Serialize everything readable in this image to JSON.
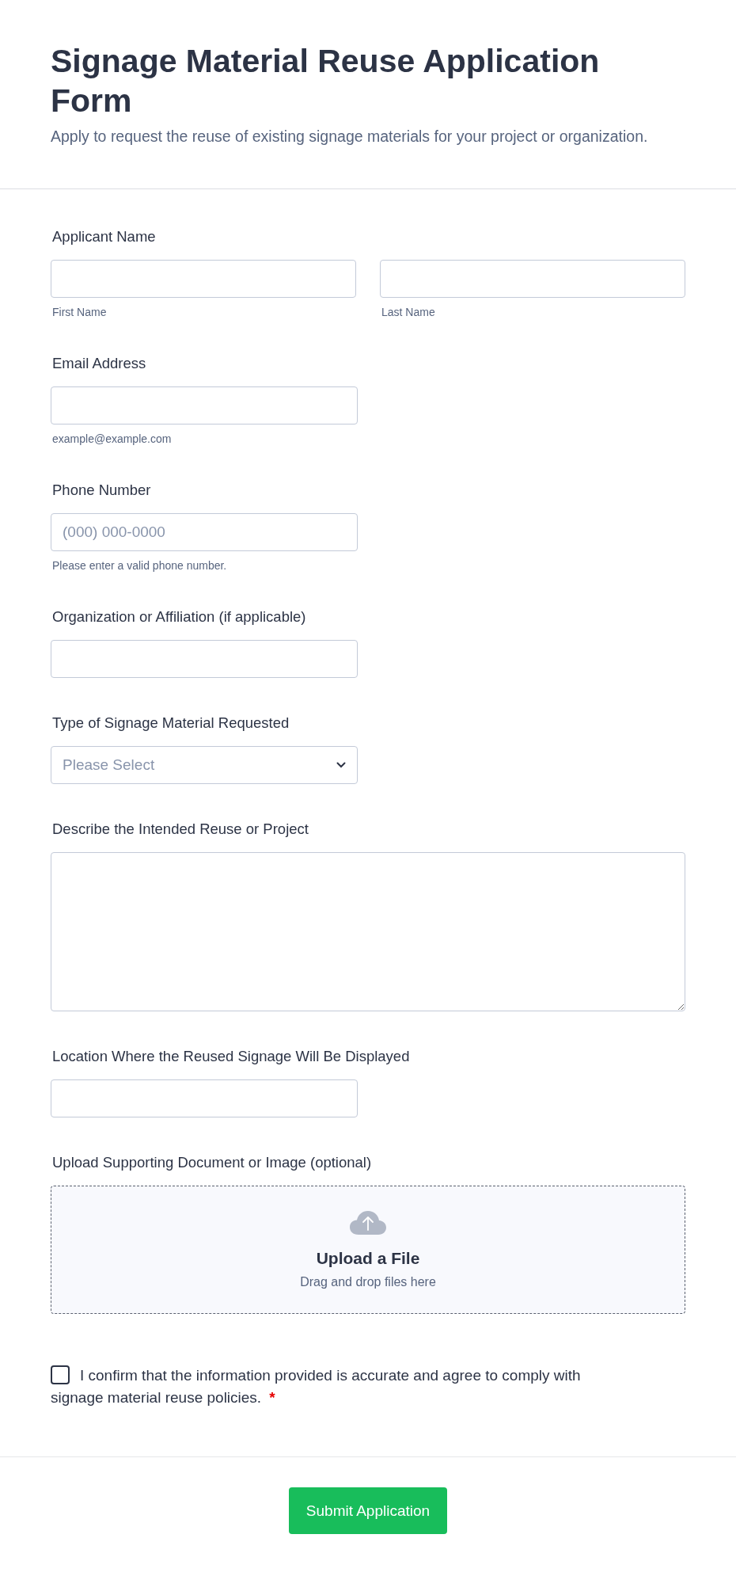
{
  "header": {
    "title": "Signage Material Reuse Application Form",
    "description": "Apply to request the reuse of existing signage materials for your project or organization."
  },
  "fields": [
    {
      "kind": "name",
      "label": "Applicant Name",
      "subfields": [
        {
          "sublabel": "First Name"
        },
        {
          "sublabel": "Last Name"
        }
      ]
    },
    {
      "kind": "text",
      "label": "Email Address",
      "sublabel": "example@example.com"
    },
    {
      "kind": "text",
      "label": "Phone Number",
      "placeholder": "(000) 000-0000",
      "sublabel": "Please enter a valid phone number."
    },
    {
      "kind": "text",
      "label": "Organization or Affiliation (if applicable)"
    },
    {
      "kind": "select",
      "label": "Type of Signage Material Requested",
      "placeholder": "Please Select"
    },
    {
      "kind": "textarea",
      "label": "Describe the Intended Reuse or Project"
    },
    {
      "kind": "text",
      "label": "Location Where the Reused Signage Will Be Displayed"
    },
    {
      "kind": "upload",
      "label": "Upload Supporting Document or Image (optional)",
      "title": "Upload a File",
      "hint": "Drag and drop files here"
    }
  ],
  "consent": {
    "text": "I confirm that the information provided is accurate and agree to comply with signage material reuse policies.",
    "checked": false,
    "required_mark": "*"
  },
  "submit": {
    "label": "Submit Application"
  }
}
